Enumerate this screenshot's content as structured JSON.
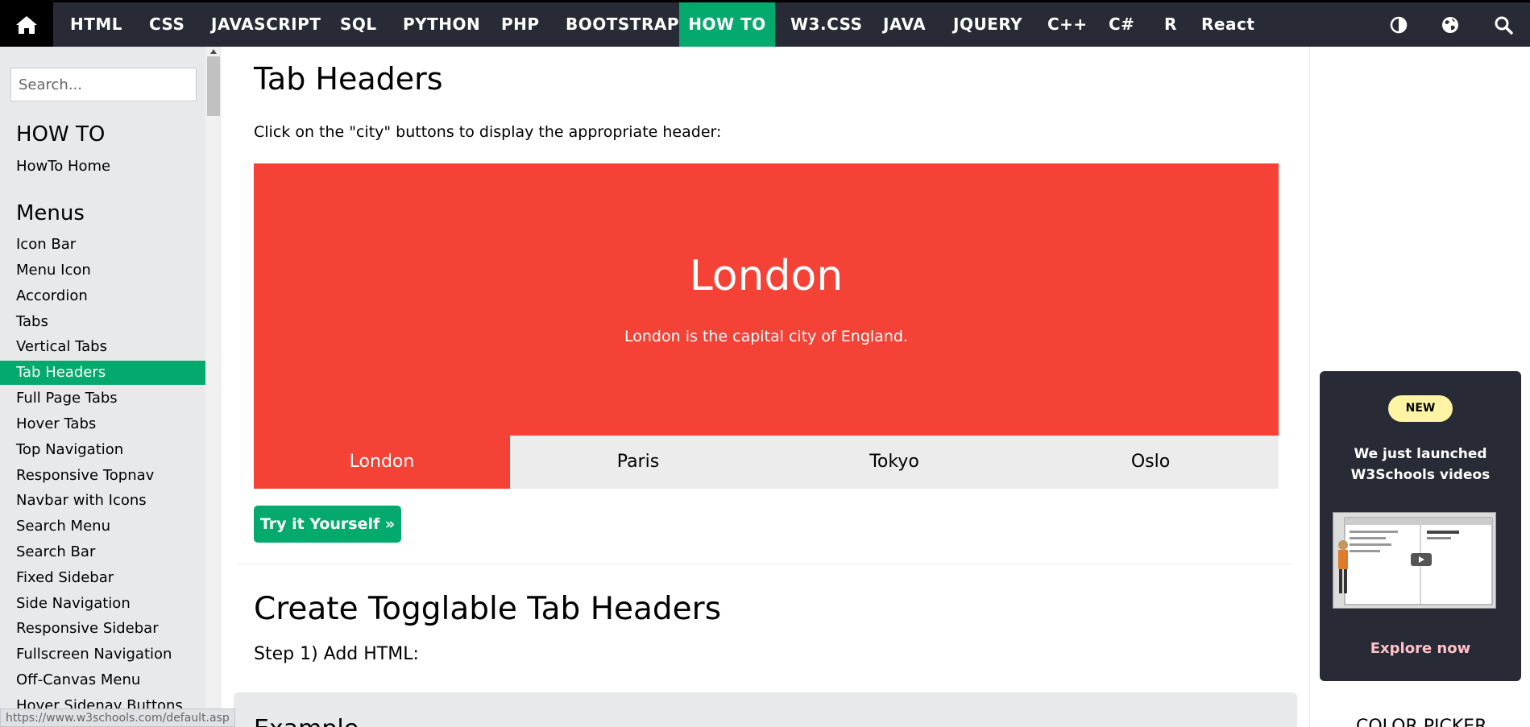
{
  "topnav": {
    "home_icon": "home-icon",
    "items": [
      {
        "label": "HTML"
      },
      {
        "label": "CSS"
      },
      {
        "label": "JAVASCRIPT"
      },
      {
        "label": "SQL"
      },
      {
        "label": "PYTHON"
      },
      {
        "label": "PHP"
      },
      {
        "label": "BOOTSTRAP"
      },
      {
        "label": "HOW TO"
      },
      {
        "label": "W3.CSS"
      },
      {
        "label": "JAVA"
      },
      {
        "label": "JQUERY"
      },
      {
        "label": "C++"
      },
      {
        "label": "C#"
      },
      {
        "label": "R"
      },
      {
        "label": "React"
      }
    ],
    "active_item": "HOW TO",
    "right_icons": [
      "contrast-icon",
      "globe-icon",
      "search-icon"
    ]
  },
  "sidebar": {
    "search_placeholder": "Search...",
    "section1": "HOW TO",
    "home_link": "HowTo Home",
    "section2": "Menus",
    "links": [
      "Icon Bar",
      "Menu Icon",
      "Accordion",
      "Tabs",
      "Vertical Tabs",
      "Tab Headers",
      "Full Page Tabs",
      "Hover Tabs",
      "Top Navigation",
      "Responsive Topnav",
      "Navbar with Icons",
      "Search Menu",
      "Search Bar",
      "Fixed Sidebar",
      "Side Navigation",
      "Responsive Sidebar",
      "Fullscreen Navigation",
      "Off-Canvas Menu",
      "Hover Sidenav Buttons"
    ],
    "active_link": "Tab Headers"
  },
  "main": {
    "title": "Tab Headers",
    "intro": "Click on the \"city\" buttons to display the appropriate header:",
    "demo": {
      "city": "London",
      "description": "London is the capital city of England.",
      "tabs": [
        "London",
        "Paris",
        "Tokyo",
        "Oslo"
      ],
      "active_tab": "London"
    },
    "try_button": "Try it Yourself »",
    "section_title": "Create Togglable Tab Headers",
    "step": "Step 1) Add HTML:",
    "example_label": "Example"
  },
  "promo": {
    "badge": "NEW",
    "headline_line1": "We just launched",
    "headline_line2": "W3Schools videos",
    "explore": "Explore now"
  },
  "color_picker_heading": "COLOR PICKER",
  "status_url": "https://www.w3schools.com/default.asp",
  "colors": {
    "nav_bg": "#282a35",
    "accent_green": "#04aa6d",
    "demo_red": "#f44336",
    "tab_gray": "#ececec",
    "sidebar_bg": "#e7e9eb"
  }
}
